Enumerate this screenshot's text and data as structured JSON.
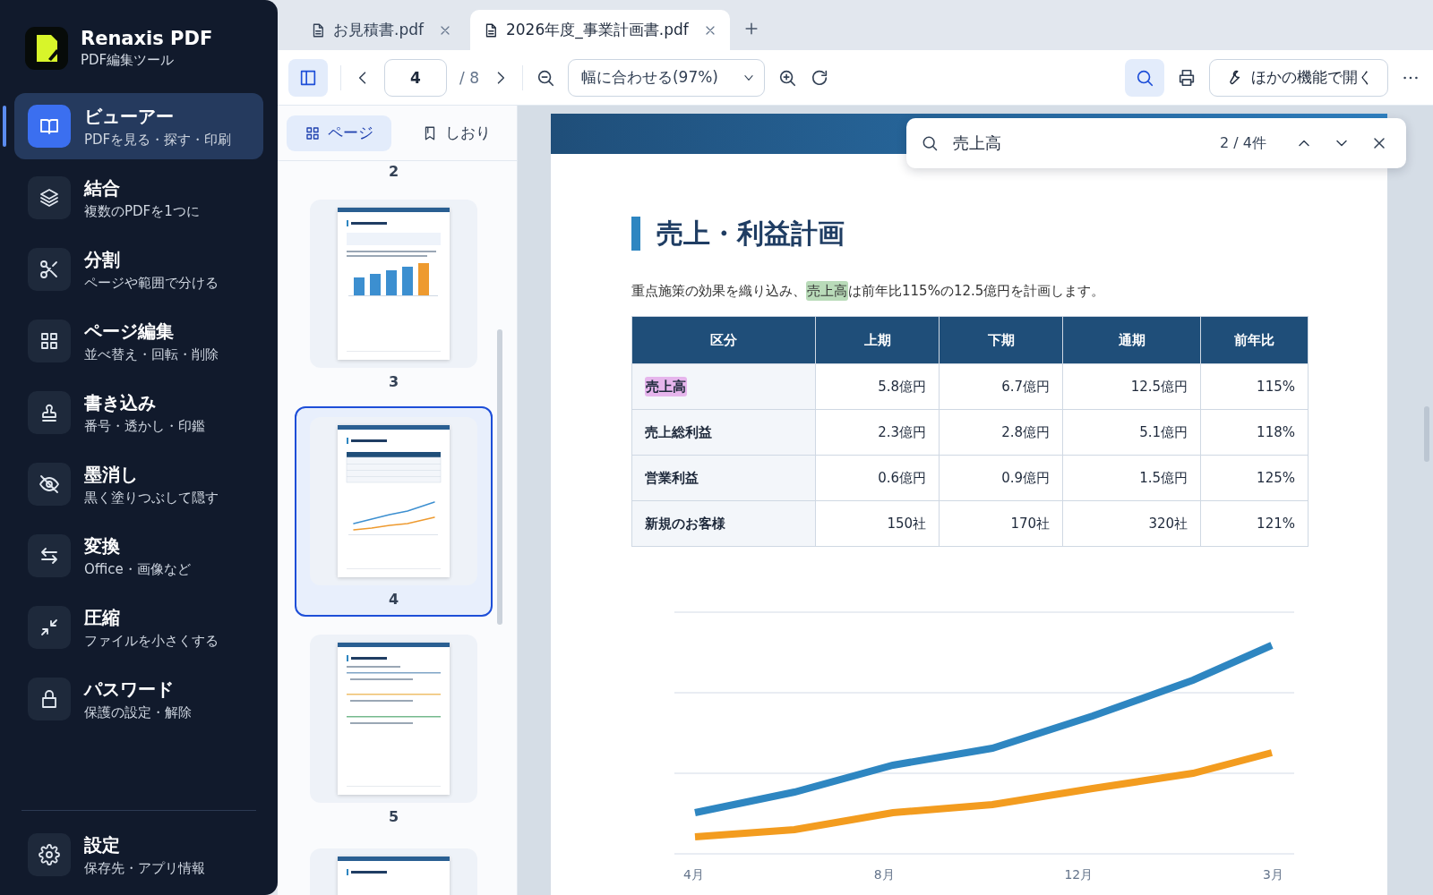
{
  "app": {
    "name": "Renaxis PDF",
    "subtitle": "PDF編集ツール"
  },
  "nav_items": [
    {
      "kind": "viewer",
      "title": "ビューアー",
      "subtitle": "PDFを見る・探す・印刷",
      "selected": true
    },
    {
      "kind": "merge",
      "title": "結合",
      "subtitle": "複数のPDFを1つに",
      "selected": false
    },
    {
      "kind": "split",
      "title": "分割",
      "subtitle": "ページや範囲で分ける",
      "selected": false
    },
    {
      "kind": "pages",
      "title": "ページ編集",
      "subtitle": "並べ替え・回転・削除",
      "selected": false
    },
    {
      "kind": "stamp",
      "title": "書き込み",
      "subtitle": "番号・透かし・印鑑",
      "selected": false
    },
    {
      "kind": "redact",
      "title": "墨消し",
      "subtitle": "黒く塗りつぶして隠す",
      "selected": false
    },
    {
      "kind": "convert",
      "title": "変換",
      "subtitle": "Office・画像など",
      "selected": false
    },
    {
      "kind": "compress",
      "title": "圧縮",
      "subtitle": "ファイルを小さくする",
      "selected": false
    },
    {
      "kind": "password",
      "title": "パスワード",
      "subtitle": "保護の設定・解除",
      "selected": false
    }
  ],
  "footer_item": {
    "kind": "settings",
    "title": "設定",
    "subtitle": "保存先・アプリ情報",
    "selected": false
  },
  "tabs": [
    {
      "title": "お見積書.pdf",
      "selected": false
    },
    {
      "title": "2026年度_事業計画書.pdf",
      "selected": true
    }
  ],
  "toolbar": {
    "sidebar_toggle_active": true,
    "page": "4",
    "page_total": "/ 8",
    "zoom": "幅に合わせる(97%)",
    "search_active": true,
    "open_with": "ほかの機能で開く"
  },
  "panel_tabs": [
    {
      "label": "ページ",
      "kind": "pages",
      "selected": true
    },
    {
      "label": "しおり",
      "kind": "bookmarks",
      "selected": false
    }
  ],
  "thumbnails": [
    {
      "label": "2",
      "kind": "hidden",
      "selected": false
    },
    {
      "label": "3",
      "kind": "bar_chart",
      "selected": false
    },
    {
      "label": "4",
      "kind": "table_chart",
      "selected": true
    },
    {
      "label": "5",
      "kind": "list",
      "selected": false
    },
    {
      "kind": "schedule",
      "selected": false
    }
  ],
  "search": {
    "query": "売上高",
    "count": "2 / 4件"
  },
  "document": {
    "heading": "売上・利益計画",
    "paragraph": [
      {
        "text": "重点施策の効果を織り込み、",
        "highlighted": false,
        "current": false
      },
      {
        "text": "売上高",
        "highlighted": true,
        "current": true
      },
      {
        "text": "は前年比115%の12.5億円を計画します。",
        "highlighted": false,
        "current": false
      }
    ],
    "table": {
      "columns": [
        "区分",
        "上期",
        "下期",
        "通期",
        "前年比"
      ],
      "rows": [
        {
          "label": "売上高",
          "highlighted": true,
          "current": false,
          "values": [
            "5.8億円",
            "6.7億円",
            "12.5億円",
            "115%"
          ]
        },
        {
          "label": "売上総利益",
          "highlighted": false,
          "current": false,
          "values": [
            "2.3億円",
            "2.8億円",
            "5.1億円",
            "118%"
          ]
        },
        {
          "label": "営業利益",
          "highlighted": false,
          "current": false,
          "values": [
            "0.6億円",
            "0.9億円",
            "1.5億円",
            "125%"
          ]
        },
        {
          "label": "新規のお客様",
          "highlighted": false,
          "current": false,
          "values": [
            "150社",
            "170社",
            "320社",
            "121%"
          ]
        }
      ]
    },
    "chart": {
      "x_labels": [
        "4月",
        "8月",
        "12月",
        "3月"
      ]
    }
  }
}
